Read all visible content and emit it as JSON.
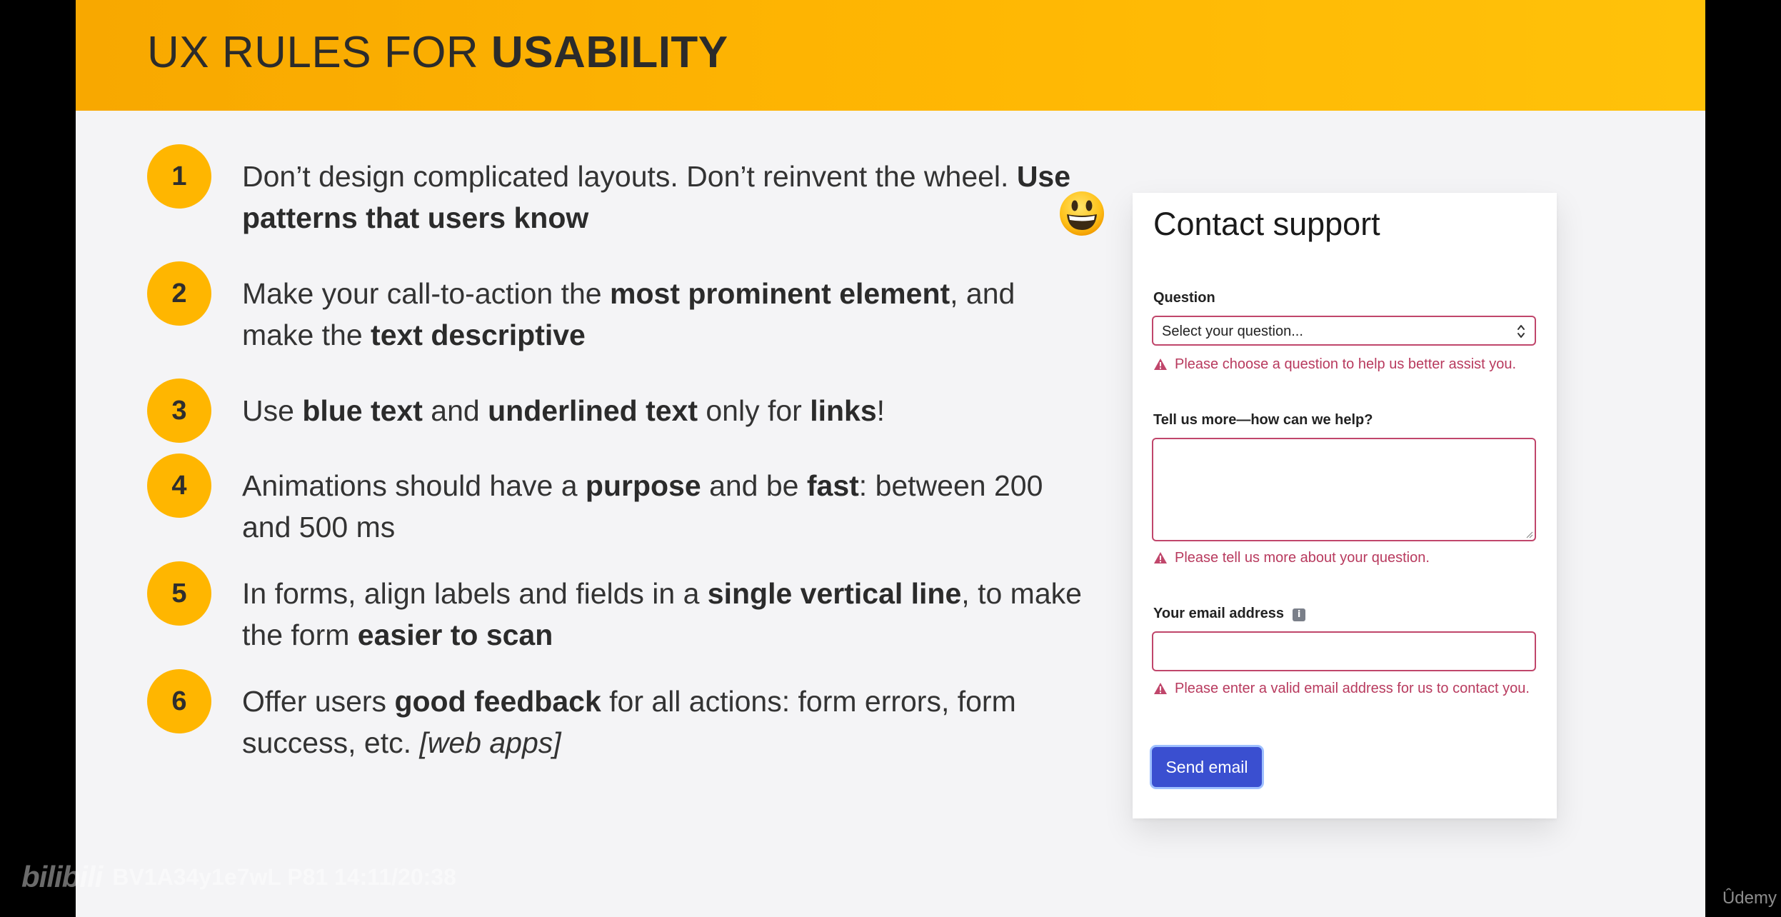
{
  "header": {
    "title_light": "UX RULES FOR ",
    "title_bold": "USABILITY"
  },
  "rules": [
    {
      "num": "1",
      "parts": [
        {
          "t": "Don’t design complicated layouts. Don’t reinvent the wheel. ",
          "b": false
        },
        {
          "t": "Use patterns that users know",
          "b": true
        }
      ]
    },
    {
      "num": "2",
      "parts": [
        {
          "t": "Make your call-to-action the ",
          "b": false
        },
        {
          "t": "most prominent element",
          "b": true
        },
        {
          "t": ", and make the ",
          "b": false
        },
        {
          "t": "text descriptive",
          "b": true
        }
      ]
    },
    {
      "num": "3",
      "parts": [
        {
          "t": "Use ",
          "b": false
        },
        {
          "t": "blue text",
          "b": true
        },
        {
          "t": " and ",
          "b": false
        },
        {
          "t": "underlined text",
          "b": true
        },
        {
          "t": " only for ",
          "b": false
        },
        {
          "t": "links",
          "b": true
        },
        {
          "t": "!",
          "b": false
        }
      ]
    },
    {
      "num": "4",
      "parts": [
        {
          "t": "Animations should have a ",
          "b": false
        },
        {
          "t": "purpose",
          "b": true
        },
        {
          "t": " and be ",
          "b": false
        },
        {
          "t": "fast",
          "b": true
        },
        {
          "t": ": between 200 and 500 ms",
          "b": false
        }
      ]
    },
    {
      "num": "5",
      "parts": [
        {
          "t": "In forms, align labels and fields in a ",
          "b": false
        },
        {
          "t": "single vertical line",
          "b": true
        },
        {
          "t": ", to make the form ",
          "b": false
        },
        {
          "t": "easier to scan",
          "b": true
        }
      ]
    },
    {
      "num": "6",
      "parts": [
        {
          "t": "Offer users ",
          "b": false
        },
        {
          "t": "good feedback",
          "b": true
        },
        {
          "t": " for all actions: form errors, form success, etc. ",
          "b": false
        },
        {
          "t": "[web apps]",
          "b": false,
          "i": true
        }
      ]
    }
  ],
  "emoji_icon": "grinning-face-icon",
  "form": {
    "title": "Contact support",
    "question_label": "Question",
    "question_value": "Select your question...",
    "question_error": "Please choose a question to help us better assist you.",
    "message_label": "Tell us more—how can we help?",
    "message_value": "",
    "message_error": "Please tell us more about your question.",
    "email_label": "Your email address",
    "email_info_icon": "i",
    "email_value": "",
    "email_error": "Please enter a valid email address for us to contact you.",
    "send_label": "Send email"
  },
  "colors": {
    "header": "#ffb703",
    "badge": "#ffb600",
    "error": "#b83a5e",
    "button": "#3a4fd0"
  },
  "watermark": {
    "logo": "bilibili",
    "video_info": "BV1A34y1e7wL P81 14:11/20:38",
    "brand": "Ûdemy"
  }
}
